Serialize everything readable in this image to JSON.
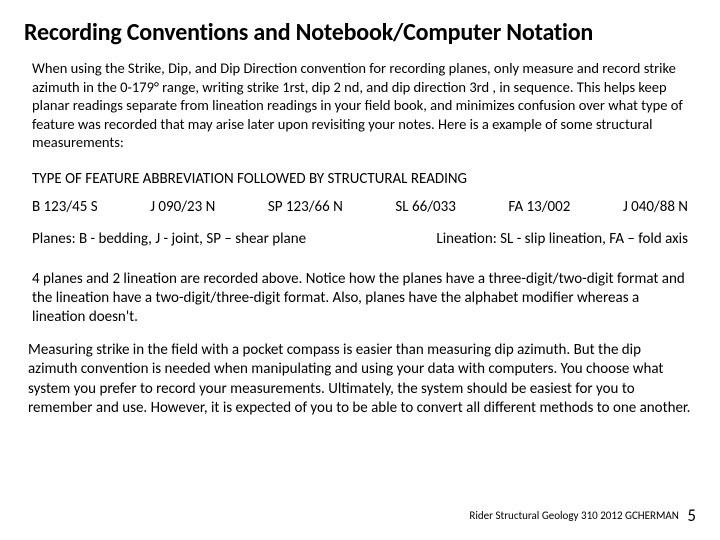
{
  "title": "Recording Conventions and Notebook/Computer Notation",
  "para1": "When using the Strike, Dip, and Dip Direction convention for recording planes, only measure and record strike azimuth in the 0-179° range, writing strike 1rst, dip 2 nd, and dip direction 3rd , in sequence. This helps keep planar readings separate from lineation readings in your field book, and minimizes confusion over what type of feature was recorded that may arise later upon revisiting your notes. Here is a example of some structural measurements:",
  "heading2": "TYPE OF FEATURE  ABBREVIATION FOLLOWED BY STRUCTURAL READING",
  "examples": {
    "e1": "B 123/45 S",
    "e2": "J 090/23 N",
    "e3": "SP 123/66 N",
    "e4": "SL 66/033",
    "e5": "FA  13/002",
    "e6": "J 040/88 N"
  },
  "legend": {
    "left": "Planes: B - bedding, J - joint,  SP – shear plane",
    "right": "Lineation: SL - slip lineation, FA – fold axis"
  },
  "para2": "4 planes and 2 lineation are recorded above. Notice how the planes have a three-digit/two-digit  format and the lineation have a two-digit/three-digit format. Also, planes have the alphabet modifier whereas a lineation doesn't.",
  "para3": "Measuring strike in the field with a pocket compass is easier than measuring dip azimuth. But the dip azimuth convention is needed when manipulating and using your data with computers. You choose what system you prefer to record your measurements. Ultimately, the system should be easiest for you to remember and use. However, it is expected of you to be able to convert all different methods to one another.",
  "footer": {
    "credit": "Rider Structural Geology 310 2012 GCHERMAN",
    "page": "5"
  }
}
